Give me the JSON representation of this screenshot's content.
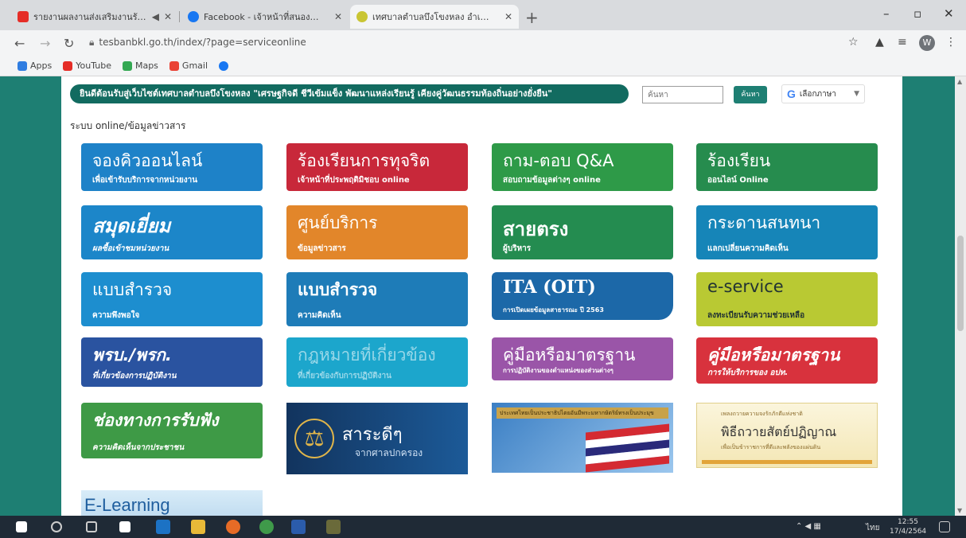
{
  "browser": {
    "tabs": [
      {
        "title": "รายงานผลงานส่งเสริมงานรัฐ - YouTube",
        "favicon_color": "#e52d27"
      },
      {
        "title": "Facebook - เจ้าหน้าที่สนองนโยบาย",
        "favicon_color": "#1877f2"
      },
      {
        "title": "เทศบาลตำบลบึงโขงหลง อำเภอบึงโขงหลง",
        "favicon_color": "#c9c533"
      }
    ],
    "new_tab": "+",
    "window_controls": {
      "minimize": "–",
      "maximize": "▫",
      "close": "✕"
    },
    "url": "tesbanbkl.go.th/index/?page=serviceonline",
    "profile_initial": "W",
    "bookmarks": [
      {
        "label": "Apps",
        "color": "#2f7de1"
      },
      {
        "label": "YouTube",
        "color": "#e52d27"
      },
      {
        "label": "Maps",
        "color": "#34a853"
      },
      {
        "label": "Gmail",
        "color": "#ea4335"
      },
      {
        "label": "",
        "color": "#1877f2"
      }
    ]
  },
  "header": {
    "marquee": "ยินดีต้อนรับสู่เว็บไซต์เทศบาลตำบลบึงโขงหลง \"เศรษฐกิจดี ชีวีเข้มแข็ง พัฒนาแหล่งเรียนรู้ เคียงคู่วัฒนธรรมท้องถิ่นอย่างยั่งยืน\"",
    "search_placeholder": "ค้นหา",
    "search_button": "ค้นหา",
    "language_label": "เลือกภาษา"
  },
  "breadcrumb": "ระบบ online/ข้อมูลข่าวสาร",
  "tiles": [
    {
      "title": "จองคิวออนไลน์",
      "subtitle": "เพื่อเข้ารับบริการจากหน่วยงาน",
      "color": "#1e82c8"
    },
    {
      "title": "ร้องเรียนการทุจริต",
      "subtitle": "เจ้าหน้าที่ประพฤติมิชอบ online",
      "color": "#c8283a"
    },
    {
      "title": "ถาม-ตอบ Q&A",
      "subtitle": "สอบถามข้อมูลต่างๆ online",
      "color": "#2e9a48"
    },
    {
      "title": "ร้องเรียน",
      "subtitle": "ออนไลน์ Online",
      "color": "#268c4e"
    },
    {
      "title": "สมุดเยี่ยม",
      "subtitle": "ผลซื้อเข้าชมหน่วยงาน",
      "color": "#1c86c9"
    },
    {
      "title": "ศูนย์บริการ",
      "subtitle": "ข้อมูลข่าวสาร",
      "color": "#e2862a"
    },
    {
      "title": "สายตรง",
      "subtitle": "ผู้บริหาร",
      "color": "#248c50"
    },
    {
      "title": "กระดานสนทนา",
      "subtitle": "แลกเปลี่ยนความคิดเห็น",
      "color": "#1685b8"
    },
    {
      "title": "แบบสำรวจ",
      "subtitle": "ความพึงพอใจ",
      "color": "#1d8ecf"
    },
    {
      "title": "แบบสำรวจ",
      "subtitle": "ความคิดเห็น",
      "color": "#1e7cb8"
    },
    {
      "title": "ITA (OIT)",
      "subtitle": "การเปิดเผยข้อมูลสาธารณะ ปี 2563",
      "color": "#1c68a8"
    },
    {
      "title": "e-service",
      "subtitle": "ลงทะเบียนรับความช่วยเหลือ",
      "color": "#b9c933"
    },
    {
      "title": "พรบ./พรก.",
      "subtitle": "ที่เกี่ยวข้องการปฏิบัติงาน",
      "color": "#2a53a0"
    },
    {
      "title": "กฎหมายที่เกี่ยวข้อง",
      "subtitle": "ที่เกี่ยวข้องกับการปฏิบัติงาน",
      "color": "#1ca6cc"
    },
    {
      "title": "คู่มือหรือมาตรฐาน",
      "subtitle": "การปฏิบัติงานของตำแหน่งของส่วนต่างๆ",
      "color": "#9a55a8"
    },
    {
      "title": "คู่มือหรือมาตรฐาน",
      "subtitle": "การให้บริการของ อปท.",
      "color": "#d8323d"
    },
    {
      "title": "ช่องทางการรับฟัง",
      "subtitle": "ความคิดเห็นจากประชาชน",
      "color": "#3e9a46"
    }
  ],
  "banners": {
    "court": {
      "title": "สาระดีๆ",
      "subtitle": "จากศาลปกครอง"
    },
    "flag": {
      "title": "ประเทศไทยเป็นประชาธิปไตยอันมีพระมหากษัตริย์ทรงเป็นประมุข"
    },
    "pledge": {
      "top": "เพลงถวายความจงรักภักดีแห่งชาติ",
      "title": "พิธีถวายสัตย์ปฏิญาณ",
      "sub": "เพื่อเป็นข้าราชการที่ดีและพลังของแผ่นดิน"
    },
    "elearning": {
      "title": "E-Learning"
    }
  },
  "taskbar": {
    "language": "ไทย",
    "time": "12:55",
    "date": "17/4/2564"
  }
}
